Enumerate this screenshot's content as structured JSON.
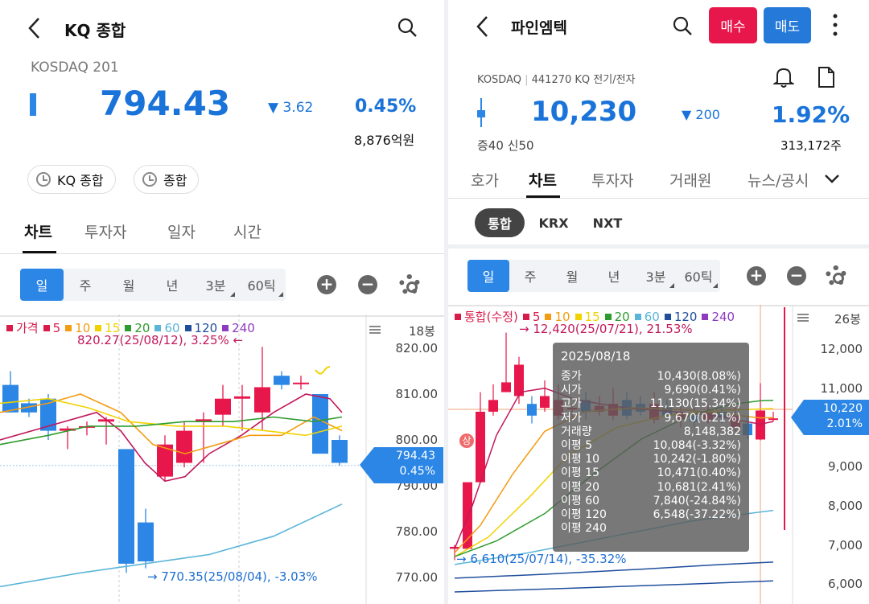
{
  "left": {
    "header": {
      "title": "KQ 종합"
    },
    "index_code": "KOSDAQ 201",
    "price": "794.43",
    "change": "3.62",
    "change_pct": "0.45%",
    "volume": "8,876억원",
    "pills": [
      "KQ 종합",
      "종합"
    ],
    "tabs": [
      "차트",
      "투자자",
      "일자",
      "시간"
    ],
    "periods": [
      "일",
      "주",
      "월",
      "년",
      "3분",
      "60틱"
    ],
    "legend": [
      {
        "label": "가격",
        "color": "#d81b4a"
      },
      {
        "label": "5",
        "color": "#d81b4a"
      },
      {
        "label": "10",
        "color": "#f39c12"
      },
      {
        "label": "15",
        "color": "#f1d200"
      },
      {
        "label": "20",
        "color": "#2e9b2e"
      },
      {
        "label": "60",
        "color": "#5bb5d8"
      },
      {
        "label": "120",
        "color": "#1f4e9c"
      },
      {
        "label": "240",
        "color": "#8e3bbf"
      }
    ],
    "bars_label": "18봉",
    "y_ticks": [
      "820.00",
      "810.00",
      "800.00",
      "790.00",
      "780.00",
      "770.00"
    ],
    "high_annotation": "820.27(25/08/12), 3.25%",
    "low_annotation": "770.35(25/08/04), -3.03%",
    "price_tag": {
      "price": "794.43",
      "pct": "0.45%"
    }
  },
  "right": {
    "header": {
      "title": "파인엠텍",
      "buy": "매수",
      "sell": "매도"
    },
    "market_info": "KOSDAQ",
    "sector_info": "441270 KQ 전기/전자",
    "price": "10,230",
    "change": "200",
    "change_pct": "1.92%",
    "margin_info": "증40 신50",
    "volume": "313,172주",
    "tabs": [
      "호가",
      "차트",
      "투자자",
      "거래원",
      "뉴스/공시"
    ],
    "markets": [
      "통합",
      "KRX",
      "NXT"
    ],
    "periods": [
      "일",
      "주",
      "월",
      "년",
      "3분",
      "60틱"
    ],
    "legend": [
      {
        "label": "통합(수정)",
        "color": "#d81b4a"
      },
      {
        "label": "5",
        "color": "#d81b4a"
      },
      {
        "label": "10",
        "color": "#f39c12"
      },
      {
        "label": "15",
        "color": "#f1d200"
      },
      {
        "label": "20",
        "color": "#2e9b2e"
      },
      {
        "label": "60",
        "color": "#5bb5d8"
      },
      {
        "label": "120",
        "color": "#1f4e9c"
      },
      {
        "label": "240",
        "color": "#8e3bbf"
      }
    ],
    "bars_label": "26봉",
    "y_ticks": [
      "12,000",
      "11,000",
      "10,000",
      "9,000",
      "8,000",
      "7,000",
      "6,000"
    ],
    "high_annotation": "12,420(25/07/21), 21.53%",
    "low_annotation": "6,610(25/07/14), -35.32%",
    "limit_badge": "상",
    "price_tag": {
      "price": "10,220",
      "pct": "2.01%"
    },
    "tooltip": {
      "date": "2025/08/18",
      "rows": [
        {
          "k": "종가",
          "v": "10,430(8.08%)"
        },
        {
          "k": "시가",
          "v": "9,690(0.41%)"
        },
        {
          "k": "고가",
          "v": "11,130(15.34%)"
        },
        {
          "k": "저가",
          "v": "9,670(0.21%)"
        },
        {
          "k": "거래량",
          "v": "8,148,382"
        },
        {
          "k": "이평 5",
          "v": "10,084(-3.32%)"
        },
        {
          "k": "이평 10",
          "v": "10,242(-1.80%)"
        },
        {
          "k": "이평 15",
          "v": "10,471(0.40%)"
        },
        {
          "k": "이평 20",
          "v": "10,681(2.41%)"
        },
        {
          "k": "이평 60",
          "v": "7,840(-24.84%)"
        },
        {
          "k": "이평 120",
          "v": "6,548(-37.22%)"
        },
        {
          "k": "이평 240",
          "v": ""
        }
      ]
    }
  },
  "colors": {
    "up": "#e8174b",
    "down": "#2b86e5",
    "accent": "#1a73d9"
  }
}
